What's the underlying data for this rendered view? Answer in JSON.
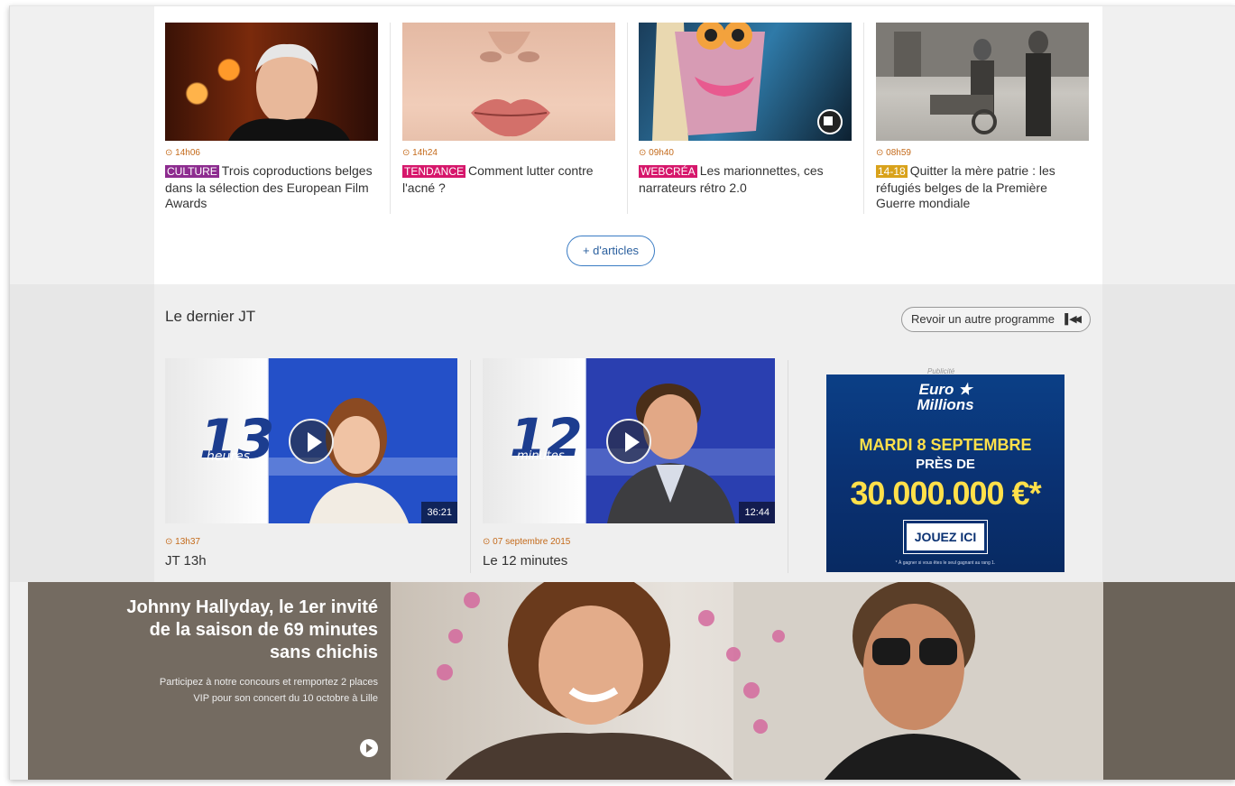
{
  "articles": [
    {
      "time": "14h06",
      "tag": "CULTURE",
      "tag_color": "#8d2c8f",
      "title": "Trois coproductions belges dans la sélection des European Film Awards"
    },
    {
      "time": "14h24",
      "tag": "TENDANCE",
      "tag_color": "#d6176b",
      "title": "Comment lutter contre l'acné ?"
    },
    {
      "time": "09h40",
      "tag": "WEBCRÉA",
      "tag_color": "#d6176b",
      "title": "Les marionnettes, ces narrateurs rétro 2.0"
    },
    {
      "time": "08h59",
      "tag": "14-18",
      "tag_color": "#d9a21b",
      "title": "Quitter la mère patrie : les réfugiés belges de la Première Guerre mondiale"
    }
  ],
  "more_articles_label": "+ d'articles",
  "jt": {
    "section_title": "Le dernier JT",
    "revoir_label": "Revoir un autre programme",
    "videos": [
      {
        "logo_number": "13",
        "logo_word": "heures",
        "duration": "36:21",
        "time": "13h37",
        "title": "JT 13h"
      },
      {
        "logo_number": "12",
        "logo_word": "minutes",
        "duration": "12:44",
        "time": "07 septembre 2015",
        "title": "Le 12 minutes"
      }
    ]
  },
  "ad": {
    "label": "Publicité",
    "brand_line1": "Euro",
    "brand_line2": "Millions",
    "date": "MARDI 8 SEPTEMBRE",
    "pres": "PRÈS DE",
    "amount": "30.000.000 €*",
    "cta": "JOUEZ ICI",
    "fine_print": "* À gagner si vous êtes le seul gagnant au rang 1."
  },
  "promo": {
    "headline": "Johnny Hallyday, le 1er invité de la saison de 69 minutes sans chichis",
    "sub": "Participez à notre concours et remportez 2 places VIP pour son concert du 10 octobre à Lille"
  },
  "colors": {
    "accent_time": "#c46a1a",
    "link_blue": "#2a5f9e"
  }
}
